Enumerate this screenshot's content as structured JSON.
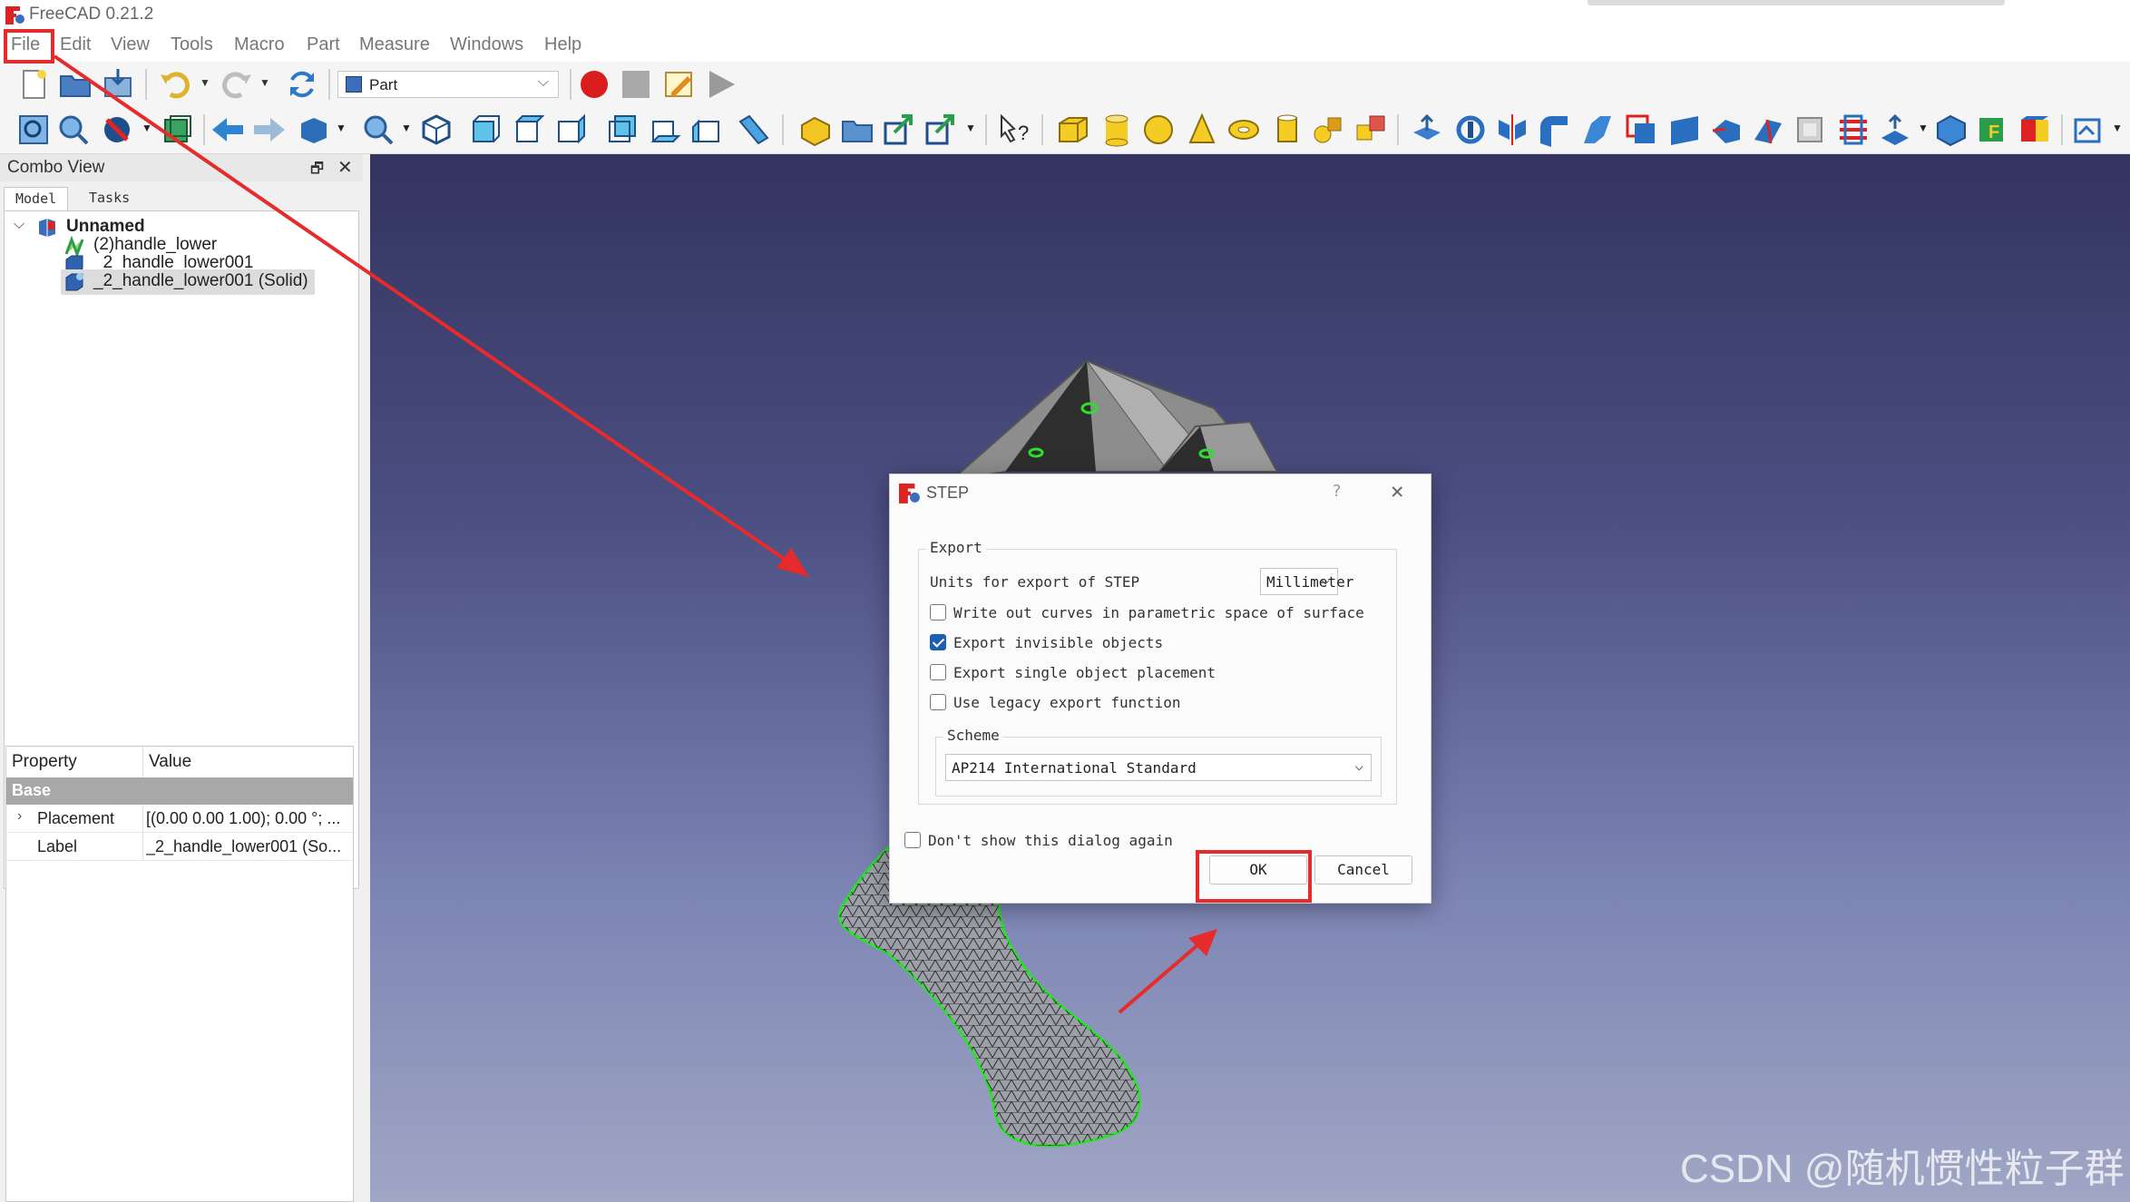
{
  "window": {
    "title": "FreeCAD 0.21.2"
  },
  "menubar": {
    "items": [
      "File",
      "Edit",
      "View",
      "Tools",
      "Macro",
      "Part",
      "Measure",
      "Windows",
      "Help"
    ]
  },
  "toolbar": {
    "workbench": "Part",
    "icons1": [
      "new-document-icon",
      "open-document-icon",
      "save-document-icon",
      "undo-icon",
      "redo-icon",
      "refresh-icon",
      "macro-record-icon",
      "macro-stop-icon",
      "macro-edit-icon",
      "macro-run-icon"
    ],
    "icons2": [
      "fit-all-icon",
      "fit-selection-icon",
      "draw-style-icon",
      "bounding-box-icon",
      "back-icon",
      "forward-icon",
      "std-views-icon",
      "zoom-icon",
      "isometric-view-icon",
      "front-view-icon",
      "top-view-icon",
      "right-view-icon",
      "rear-view-icon",
      "bottom-view-icon",
      "left-view-icon",
      "measure-distance-icon",
      "create-part-icon",
      "group-icon",
      "link-icon",
      "link-actions-icon",
      "whats-this-icon",
      "box-icon",
      "cylinder-icon",
      "sphere-icon",
      "cone-icon",
      "torus-icon",
      "tube-icon",
      "primitives-icon",
      "shape-builder-icon",
      "extrude-icon",
      "revolve-icon",
      "mirror-icon",
      "fillet-icon",
      "chamfer-icon",
      "make-face-icon",
      "ruled-surface-icon",
      "loft-icon",
      "sweep-icon",
      "section-icon",
      "cross-sections-icon",
      "offset-icon",
      "thickness-icon",
      "projection-icon",
      "check-geometry-icon",
      "defeaturing-icon",
      "color-per-face-icon"
    ]
  },
  "combo_view": {
    "title": "Combo View",
    "tabs": [
      "Model",
      "Tasks"
    ],
    "tree": {
      "root": "Unnamed",
      "items": [
        {
          "label": "(2)handle_lower",
          "icon": "mesh-icon",
          "selected": false
        },
        {
          "label": "_2_handle_lower001",
          "icon": "shape-icon",
          "selected": false
        },
        {
          "label": "_2_handle_lower001 (Solid)",
          "icon": "solid-icon",
          "selected": true
        }
      ]
    },
    "properties": {
      "headers": [
        "Property",
        "Value"
      ],
      "group": "Base",
      "rows": [
        {
          "name": "Placement",
          "value": "[(0.00 0.00 1.00); 0.00 °; ..."
        },
        {
          "name": "Label",
          "value": "_2_handle_lower001 (So..."
        }
      ]
    }
  },
  "dialog": {
    "title": "STEP",
    "help": "?",
    "group_title": "Export",
    "units_label": "Units for export of STEP",
    "units_value": "Millimeter",
    "options": [
      {
        "label": "Write out curves in parametric space of surface",
        "checked": false
      },
      {
        "label": "Export invisible objects",
        "checked": true
      },
      {
        "label": "Export single object placement",
        "checked": false
      },
      {
        "label": "Use legacy export function",
        "checked": false
      }
    ],
    "scheme_title": "Scheme",
    "scheme_value": "AP214 International Standard",
    "dont_show": {
      "label": "Don't show this dialog again",
      "checked": false
    },
    "ok_label": "OK",
    "cancel_label": "Cancel"
  },
  "watermark": "CSDN @随机惯性粒子群",
  "colors": {
    "annotation": "#e52b2b",
    "viewport_top": "#33345f",
    "viewport_bottom": "#a0a6c4",
    "check_accent": "#1a5fb4"
  }
}
